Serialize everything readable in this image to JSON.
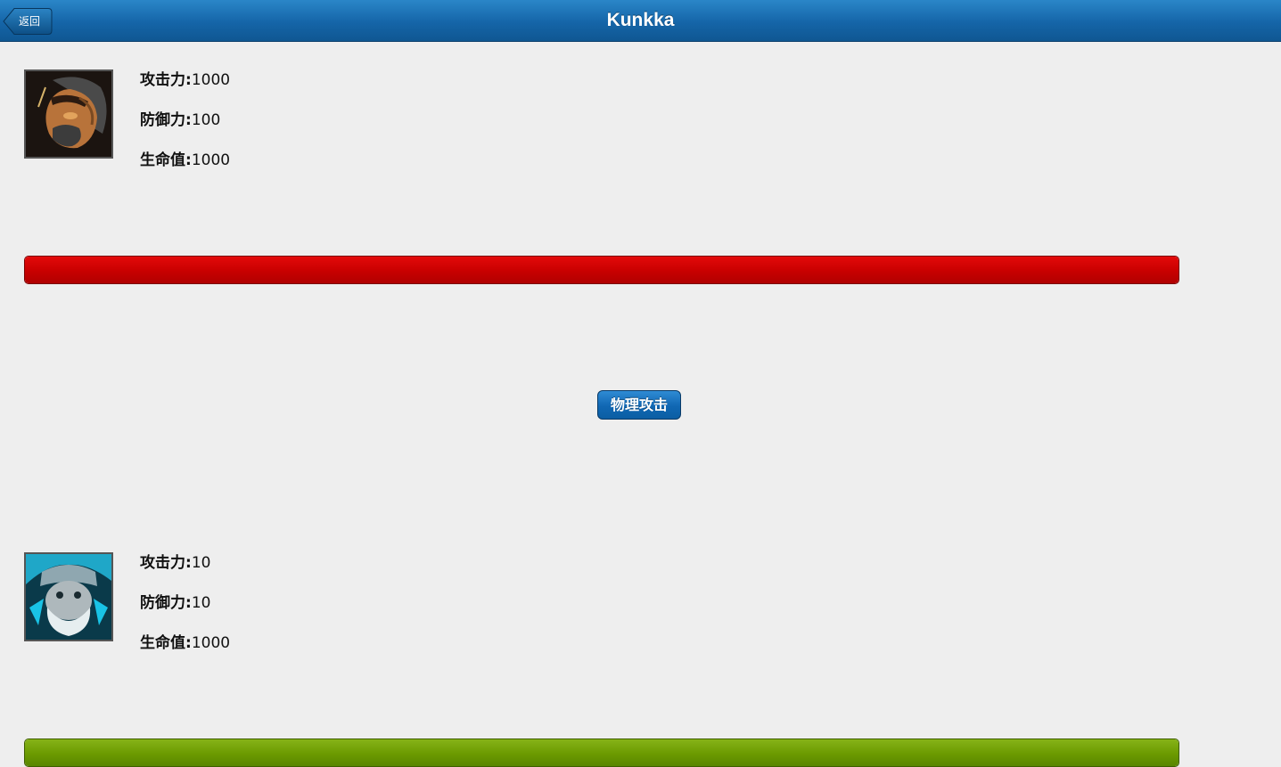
{
  "header": {
    "title": "Kunkka",
    "back_label": "返回",
    "bar_color": "#1565a8"
  },
  "player": {
    "portrait_icon": "kunkka-portrait-icon",
    "stats": [
      {
        "key": "攻击力:",
        "value": "1000"
      },
      {
        "key": "防御力:",
        "value": "100"
      },
      {
        "key": "生命值:",
        "value": "1000"
      }
    ],
    "hp_fraction": 1.0,
    "hp_color": "#cc0000"
  },
  "action": {
    "attack_label": "物理攻击"
  },
  "enemy": {
    "portrait_icon": "frost-warrior-portrait-icon",
    "stats": [
      {
        "key": "攻击力:",
        "value": "10"
      },
      {
        "key": "防御力:",
        "value": "10"
      },
      {
        "key": "生命值:",
        "value": "1000"
      }
    ],
    "hp_fraction": 1.0,
    "hp_color": "#6b9a00"
  }
}
